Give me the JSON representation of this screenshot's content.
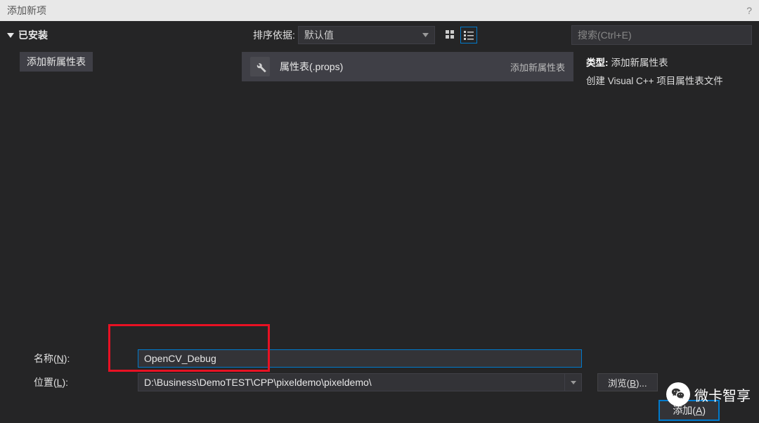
{
  "window": {
    "title": "添加新项",
    "help": "?"
  },
  "sidebar": {
    "root": "已安装",
    "child": "添加新属性表"
  },
  "toolbar": {
    "sort_label": "排序依据:",
    "sort_value": "默认值",
    "search_placeholder": "搜索(Ctrl+E)"
  },
  "template": {
    "name": "属性表(.props)",
    "type": "添加新属性表"
  },
  "details": {
    "type_label": "类型:",
    "type_value": "添加新属性表",
    "desc": "创建 Visual C++ 项目属性表文件"
  },
  "form": {
    "name_label_pre": "名称(",
    "name_label_u": "N",
    "name_label_post": "):",
    "name_value": "OpenCV_Debug",
    "loc_label_pre": "位置(",
    "loc_label_u": "L",
    "loc_label_post": "):",
    "loc_value": "D:\\Business\\DemoTEST\\CPP\\pixeldemo\\pixeldemo\\",
    "browse_pre": "浏览(",
    "browse_u": "B",
    "browse_post": ")",
    "add_pre": "添加(",
    "add_u": "A",
    "add_post": ")"
  },
  "watermark": "微卡智享"
}
